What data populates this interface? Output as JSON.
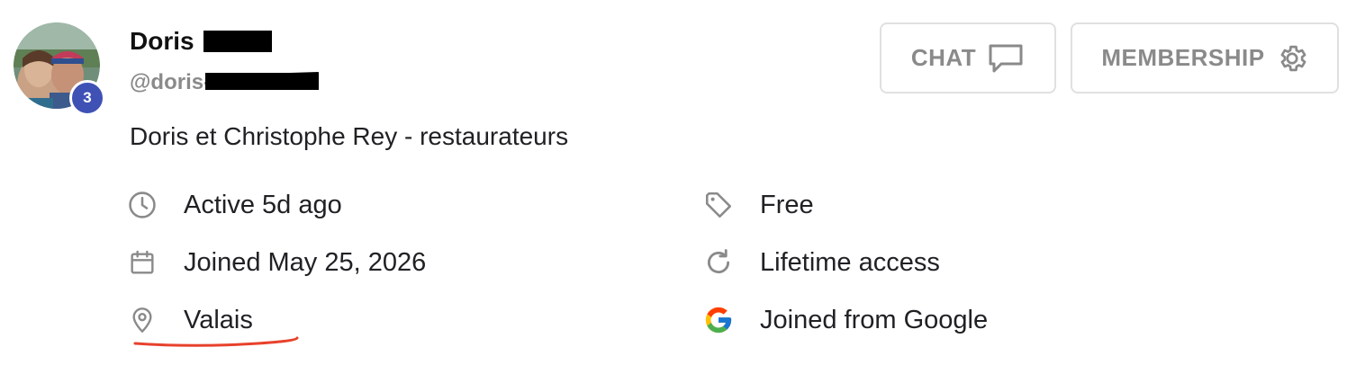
{
  "profile": {
    "name_visible": "Doris",
    "handle_visible": "@doris-",
    "level": "3",
    "bio": "Doris et Christophe Rey - restaurateurs"
  },
  "actions": {
    "chat_label": "CHAT",
    "membership_label": "MEMBERSHIP"
  },
  "details": {
    "active": "Active 5d ago",
    "joined": "Joined May 25, 2026",
    "location": "Valais",
    "plan": "Free",
    "access": "Lifetime access",
    "source": "Joined from Google"
  },
  "icons": {
    "chat": "chat-bubble-icon",
    "membership": "gear-icon",
    "active": "clock-icon",
    "joined": "calendar-icon",
    "location": "location-pin-icon",
    "plan": "tag-icon",
    "access": "refresh-icon",
    "source": "google-icon"
  },
  "colors": {
    "level_badge": "#3f51b5",
    "muted_text": "#8a8a8a",
    "icon_gray": "#8a8a8a",
    "annotation_red": "#e8412c",
    "button_border": "#e0e0e0"
  }
}
